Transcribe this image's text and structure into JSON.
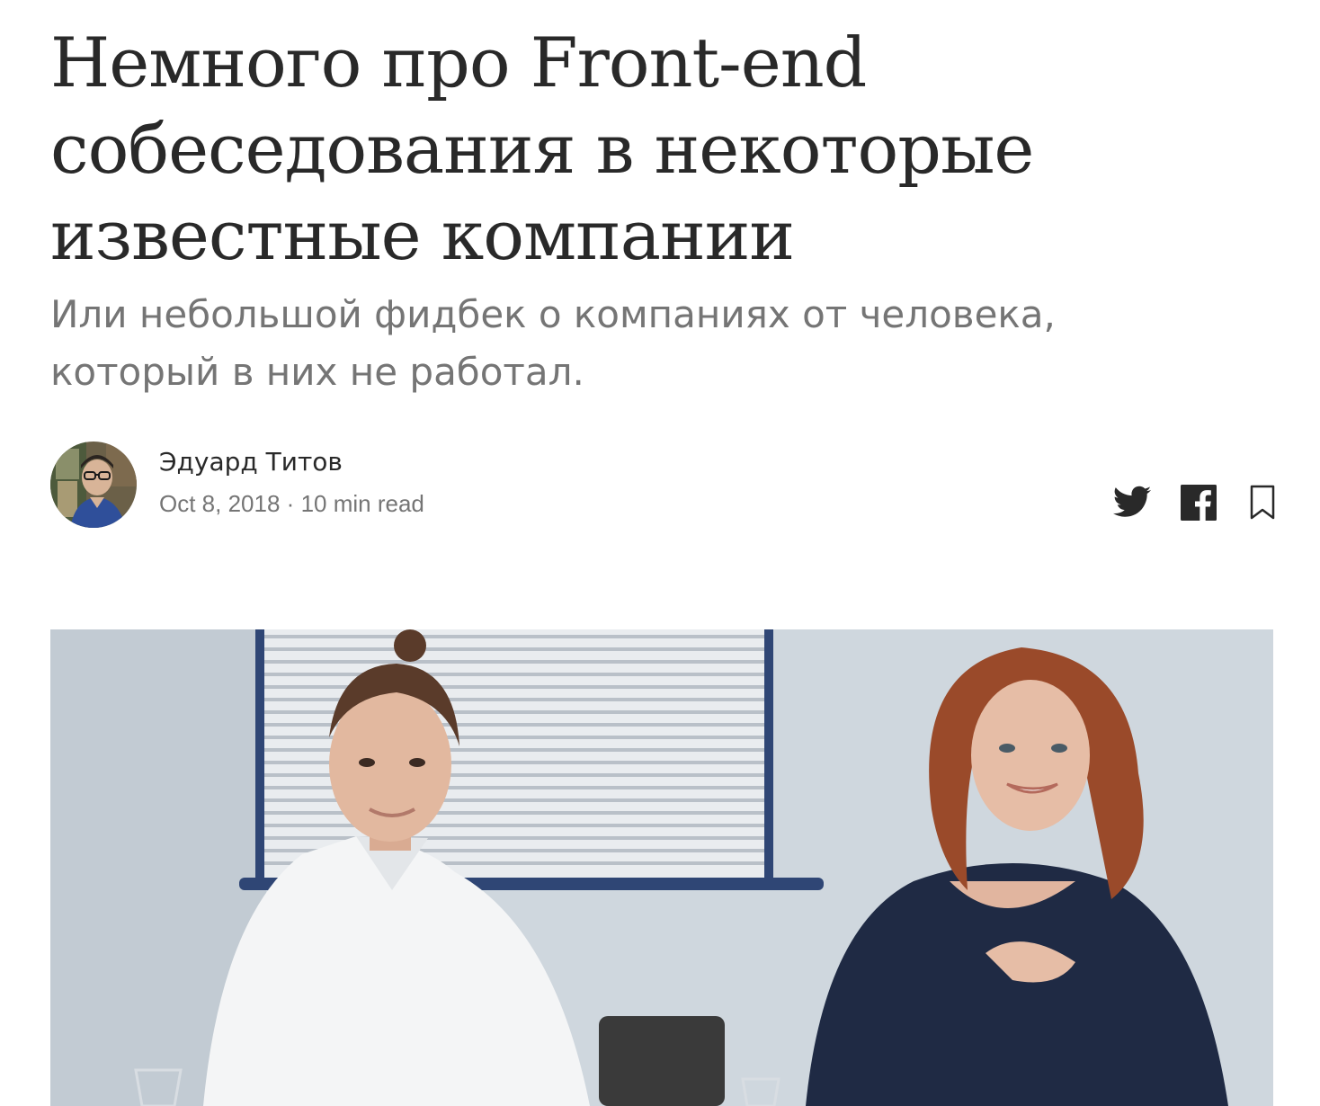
{
  "article": {
    "title_lines": [
      "Немного про Front-end",
      "собеседования в некоторые",
      "известные компании"
    ],
    "subtitle_lines": [
      "Или небольшой фидбек о компаниях от человека,",
      "который в них не работал."
    ]
  },
  "author": {
    "name": "Эдуард Титов",
    "date": "Oct 8, 2018",
    "separator": "·",
    "read_time": "10 min read"
  },
  "share": {
    "icons": [
      "twitter-icon",
      "facebook-icon",
      "bookmark-icon"
    ],
    "icon_color": "#292929"
  },
  "colors": {
    "text": "#292929",
    "muted": "#757575",
    "background": "#ffffff"
  }
}
